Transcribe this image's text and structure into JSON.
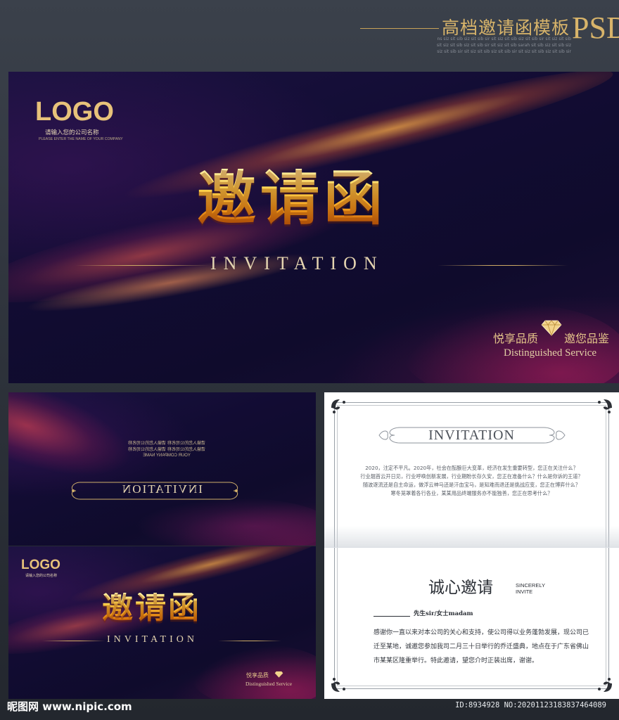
{
  "header": {
    "title": "高档邀请函模板",
    "format": "PSD",
    "fine_print": [
      "ns siz sit sib siz sit sib sir sit siz sit sib siz sit sib sir sit siz sit sib",
      "sit siz sit sib siz sit sib sir sit siz sit sib sarah sit sib siz sit sib siz",
      "siz sit sib sir sit siz sit sib siz sit sib sir sit siz sit sib siz sit sib sir"
    ]
  },
  "front_cover": {
    "logo": "LOGO",
    "company_cn": "请输入您的公司名称",
    "company_en": "PLEASE ENTER THE NAME OF YOUR COMPANY",
    "title": "邀请函",
    "subtitle": "INVITATION",
    "slogan_left": "悦享品质",
    "slogan_right": "邀您品鉴",
    "slogan_en": "Distinguished Service"
  },
  "back_cover": {
    "company_en_mirrored": "YOUR COMPANY NAME",
    "label_mirrored": "INVITATION",
    "fine_mirrored": "请输入您的公司名称 请输入您的公司名称"
  },
  "small_cover": {
    "logo": "LOGO",
    "company_cn": "请输入您的公司名称",
    "title": "邀请函",
    "subtitle": "INVITATION",
    "slogan_cn": "悦享品质",
    "slogan_en": "Distinguished Service"
  },
  "inside": {
    "heading": "INVITATION",
    "paragraph": [
      "2020，注定不平凡。2020年，社会在酝酿巨大变革，经济在发生重要转型，您正在关注什么？",
      "行业翘首云开日见，行业呼唤创新发展，行业期盼长存久安，您正在准备什么？什么是你诉的王道？",
      "随波逐流还是自主命运，做浮云神马还是汗血宝马，是知难而退还是挑战应变，您正在博弈什么？",
      "寒冬笼罩着各行各业，某某用品终端服务亦不能独善，您正在思考什么？"
    ],
    "sincere_cn": "诚心邀请",
    "sincere_en_1": "SINCERELY",
    "sincere_en_2": "INVITE",
    "dear": "先生sir/女士madam",
    "body": [
      "感谢你一直以来对本公司的关心和支持，使公司得以业务蓬勃发展，现公司已",
      "迁至某地，诚邀您参加我司二月三十日举行的乔迁盛典，地点在于广东省佛山",
      "市某某区隆重举行。特此邀请，望您介时正装出席，谢谢。"
    ]
  },
  "footer": {
    "watermark": "昵图网 www.nipic.com",
    "id_text": "ID:8934928 NO:20201123183837464089"
  },
  "colors": {
    "gold": "#d8b46a",
    "dark_bg": "#120c33",
    "page_bg": "#2c3139"
  }
}
